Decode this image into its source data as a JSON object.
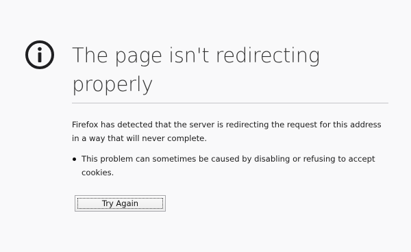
{
  "error": {
    "icon": "info-icon",
    "title": "The page isn't redirecting properly",
    "description": "Firefox has detected that the server is redirecting the request for this address in a way that will never complete.",
    "bullets": [
      "This problem can sometimes be caused by disabling or refusing to accept cookies."
    ],
    "try_again_label": "Try Again"
  },
  "colors": {
    "background": "#f9f9fa",
    "text": "#0c0c0d",
    "divider": "#c6c6c9"
  }
}
